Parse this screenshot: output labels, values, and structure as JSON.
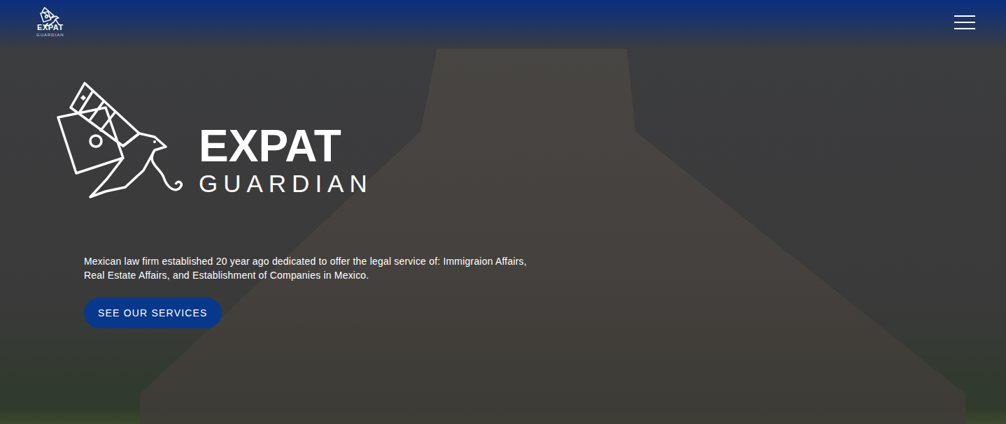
{
  "header": {
    "logo": {
      "title": "EXPAT",
      "subtitle": "GUARDIAN"
    }
  },
  "hero": {
    "logo": {
      "title": "EXPAT",
      "subtitle": "GUARDIAN"
    },
    "description": "Mexican law firm established 20 year ago dedicated to offer the legal service of: Immigraion Affairs, Real Estate Affairs, and Establishment of Companies in Mexico.",
    "button": "SEE OUR SERVICES"
  }
}
